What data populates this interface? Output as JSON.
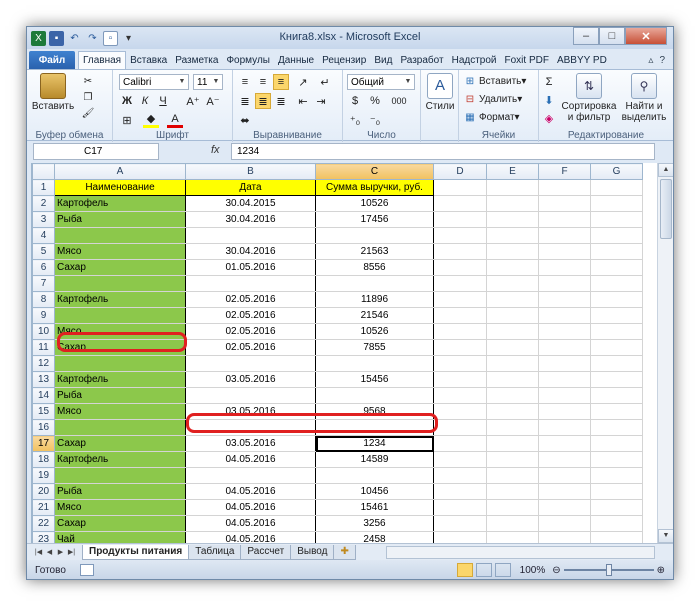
{
  "window": {
    "title": "Книга8.xlsx - Microsoft Excel",
    "minimize": "–",
    "maximize": "□",
    "close": "✕"
  },
  "tabs": [
    "Файл",
    "Главная",
    "Вставка",
    "Разметка",
    "Формулы",
    "Данные",
    "Рецензир",
    "Вид",
    "Разработ",
    "Надстрой",
    "Foxit PDF",
    "ABBYY PD"
  ],
  "ribbon": {
    "clipboard": {
      "paste": "Вставить",
      "label": "Буфер обмена"
    },
    "font": {
      "name": "Calibri",
      "size": "11",
      "bold": "Ж",
      "italic": "К",
      "underline": "Ч",
      "label": "Шрифт"
    },
    "alignment": {
      "label": "Выравнивание"
    },
    "number": {
      "format": "Общий",
      "percent": "%",
      "thousands": "000",
      "label": "Число"
    },
    "styles": {
      "label": "Стили"
    },
    "cells": {
      "insert": "Вставить",
      "delete": "Удалить",
      "format": "Формат",
      "label": "Ячейки"
    },
    "editing": {
      "sort": "Сортировка и фильтр",
      "find": "Найти и выделить",
      "label": "Редактирование"
    }
  },
  "formula_bar": {
    "name_box": "C17",
    "fx": "fx",
    "value": "1234"
  },
  "columns": [
    "A",
    "B",
    "C",
    "D",
    "E",
    "F",
    "G"
  ],
  "header_row": [
    "Наименование",
    "Дата",
    "Сумма выручки, руб."
  ],
  "rows": [
    {
      "n": "2",
      "a": "Картофель",
      "b": "30.04.2015",
      "c": "10526"
    },
    {
      "n": "3",
      "a": "Рыба",
      "b": "30.04.2016",
      "c": "17456"
    },
    {
      "n": "4",
      "a": "",
      "b": "",
      "c": ""
    },
    {
      "n": "5",
      "a": "Мясо",
      "b": "30.04.2016",
      "c": "21563"
    },
    {
      "n": "6",
      "a": "Сахар",
      "b": "01.05.2016",
      "c": "8556"
    },
    {
      "n": "7",
      "a": "",
      "b": "",
      "c": ""
    },
    {
      "n": "8",
      "a": "Картофель",
      "b": "02.05.2016",
      "c": "11896"
    },
    {
      "n": "9",
      "a": "",
      "b": "02.05.2016",
      "c": "21546"
    },
    {
      "n": "10",
      "a": "Мясо",
      "b": "02.05.2016",
      "c": "10526"
    },
    {
      "n": "11",
      "a": "Сахар",
      "b": "02.05.2016",
      "c": "7855"
    },
    {
      "n": "12",
      "a": "",
      "b": "",
      "c": ""
    },
    {
      "n": "13",
      "a": "Картофель",
      "b": "03.05.2016",
      "c": "15456"
    },
    {
      "n": "14",
      "a": "Рыба",
      "b": "",
      "c": ""
    },
    {
      "n": "15",
      "a": "Мясо",
      "b": "03.05.2016",
      "c": "9568"
    },
    {
      "n": "16",
      "a": "",
      "b": "",
      "c": ""
    },
    {
      "n": "17",
      "a": "Сахар",
      "b": "03.05.2016",
      "c": "1234"
    },
    {
      "n": "18",
      "a": "Картофель",
      "b": "04.05.2016",
      "c": "14589"
    },
    {
      "n": "19",
      "a": "",
      "b": "",
      "c": ""
    },
    {
      "n": "20",
      "a": "Рыба",
      "b": "04.05.2016",
      "c": "10456"
    },
    {
      "n": "21",
      "a": "Мясо",
      "b": "04.05.2016",
      "c": "15461"
    },
    {
      "n": "22",
      "a": "Сахар",
      "b": "04.05.2016",
      "c": "3256"
    },
    {
      "n": "23",
      "a": "Чай",
      "b": "04.05.2016",
      "c": "2458"
    }
  ],
  "sheets": [
    "Продукты питания",
    "Таблица",
    "Рассчет",
    "Вывод"
  ],
  "status": {
    "ready": "Готово",
    "zoom": "100%"
  }
}
